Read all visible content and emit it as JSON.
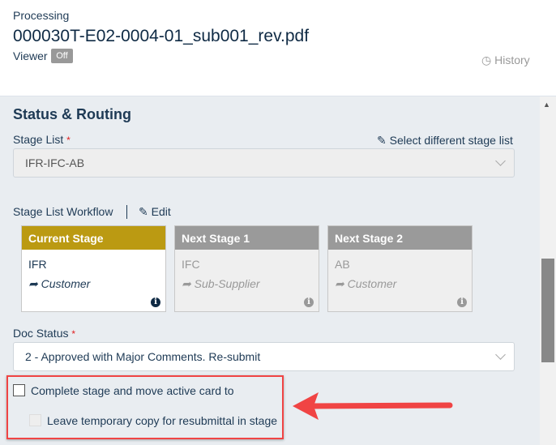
{
  "header": {
    "subtitle": "Processing",
    "filename": "000030T-E02-0004-01_sub001_rev.pdf",
    "viewer_label": "Viewer",
    "viewer_state": "Off",
    "history_label": "History"
  },
  "section": {
    "title": "Status & Routing"
  },
  "stage_list": {
    "label": "Stage List",
    "required": "*",
    "select_different": "Select different stage list",
    "value": "IFR-IFC-AB"
  },
  "workflow": {
    "label": "Stage List Workflow",
    "edit_label": "Edit",
    "cards": [
      {
        "header": "Current Stage",
        "stage": "IFR",
        "recipient": "Customer",
        "header_color": "#bb9a12"
      },
      {
        "header": "Next Stage 1",
        "stage": "IFC",
        "recipient": "Sub-Supplier",
        "header_color": "#9a9a9a"
      },
      {
        "header": "Next Stage 2",
        "stage": "AB",
        "recipient": "Customer",
        "header_color": "#9a9a9a"
      }
    ]
  },
  "doc_status": {
    "label": "Doc Status",
    "required": "*",
    "value": "2 - Approved with Major Comments. Re-submit"
  },
  "options": {
    "complete_stage": "Complete stage and move active card to",
    "complete_checked": false,
    "leave_copy": "Leave temporary copy for resubmittal in stage",
    "leave_copy_checked": false,
    "leave_copy_disabled": true
  },
  "annotation": {
    "highlight_color": "#f04444"
  }
}
